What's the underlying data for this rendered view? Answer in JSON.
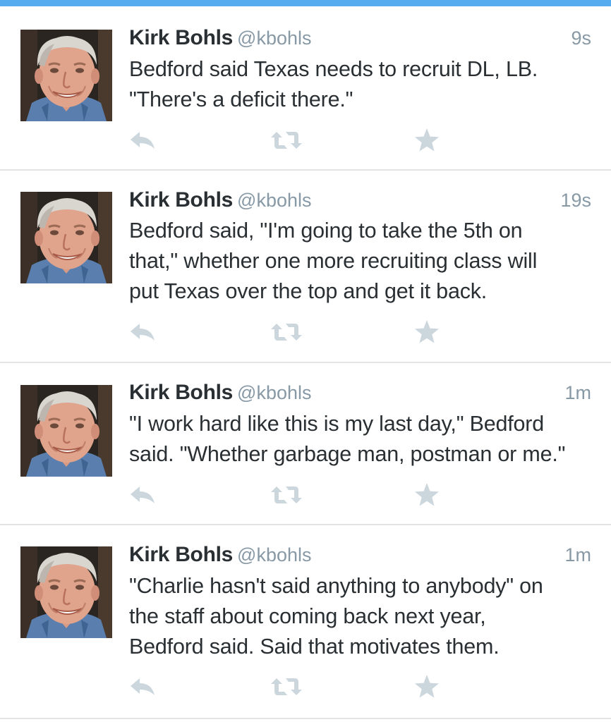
{
  "colors": {
    "top_bar": "#55acee",
    "muted": "#8899a6",
    "action_icon": "#ccd6dd",
    "text": "#292f33"
  },
  "icons": {
    "reply": "reply-icon",
    "retweet": "retweet-icon",
    "favorite": "star-icon"
  },
  "tweets": [
    {
      "author": "Kirk Bohls",
      "handle": "@kbohls",
      "time": "9s",
      "lines": [
        "Bedford said Texas needs to recruit DL, LB.",
        "\"There's a deficit there.\""
      ]
    },
    {
      "author": "Kirk Bohls",
      "handle": "@kbohls",
      "time": "19s",
      "lines": [
        "Bedford said, \"I'm going to take the 5th on",
        "that,\" whether one more recruiting class will",
        "put Texas over the top and get it back."
      ]
    },
    {
      "author": "Kirk Bohls",
      "handle": "@kbohls",
      "time": "1m",
      "lines": [
        "\"I work hard like this is my last day,\" Bedford",
        "said. \"Whether garbage man, postman or me.\""
      ]
    },
    {
      "author": "Kirk Bohls",
      "handle": "@kbohls",
      "time": "1m",
      "lines": [
        "\"Charlie hasn't said anything to anybody\" on",
        "the staff about coming back next year,",
        "Bedford said. Said that motivates them."
      ]
    }
  ]
}
